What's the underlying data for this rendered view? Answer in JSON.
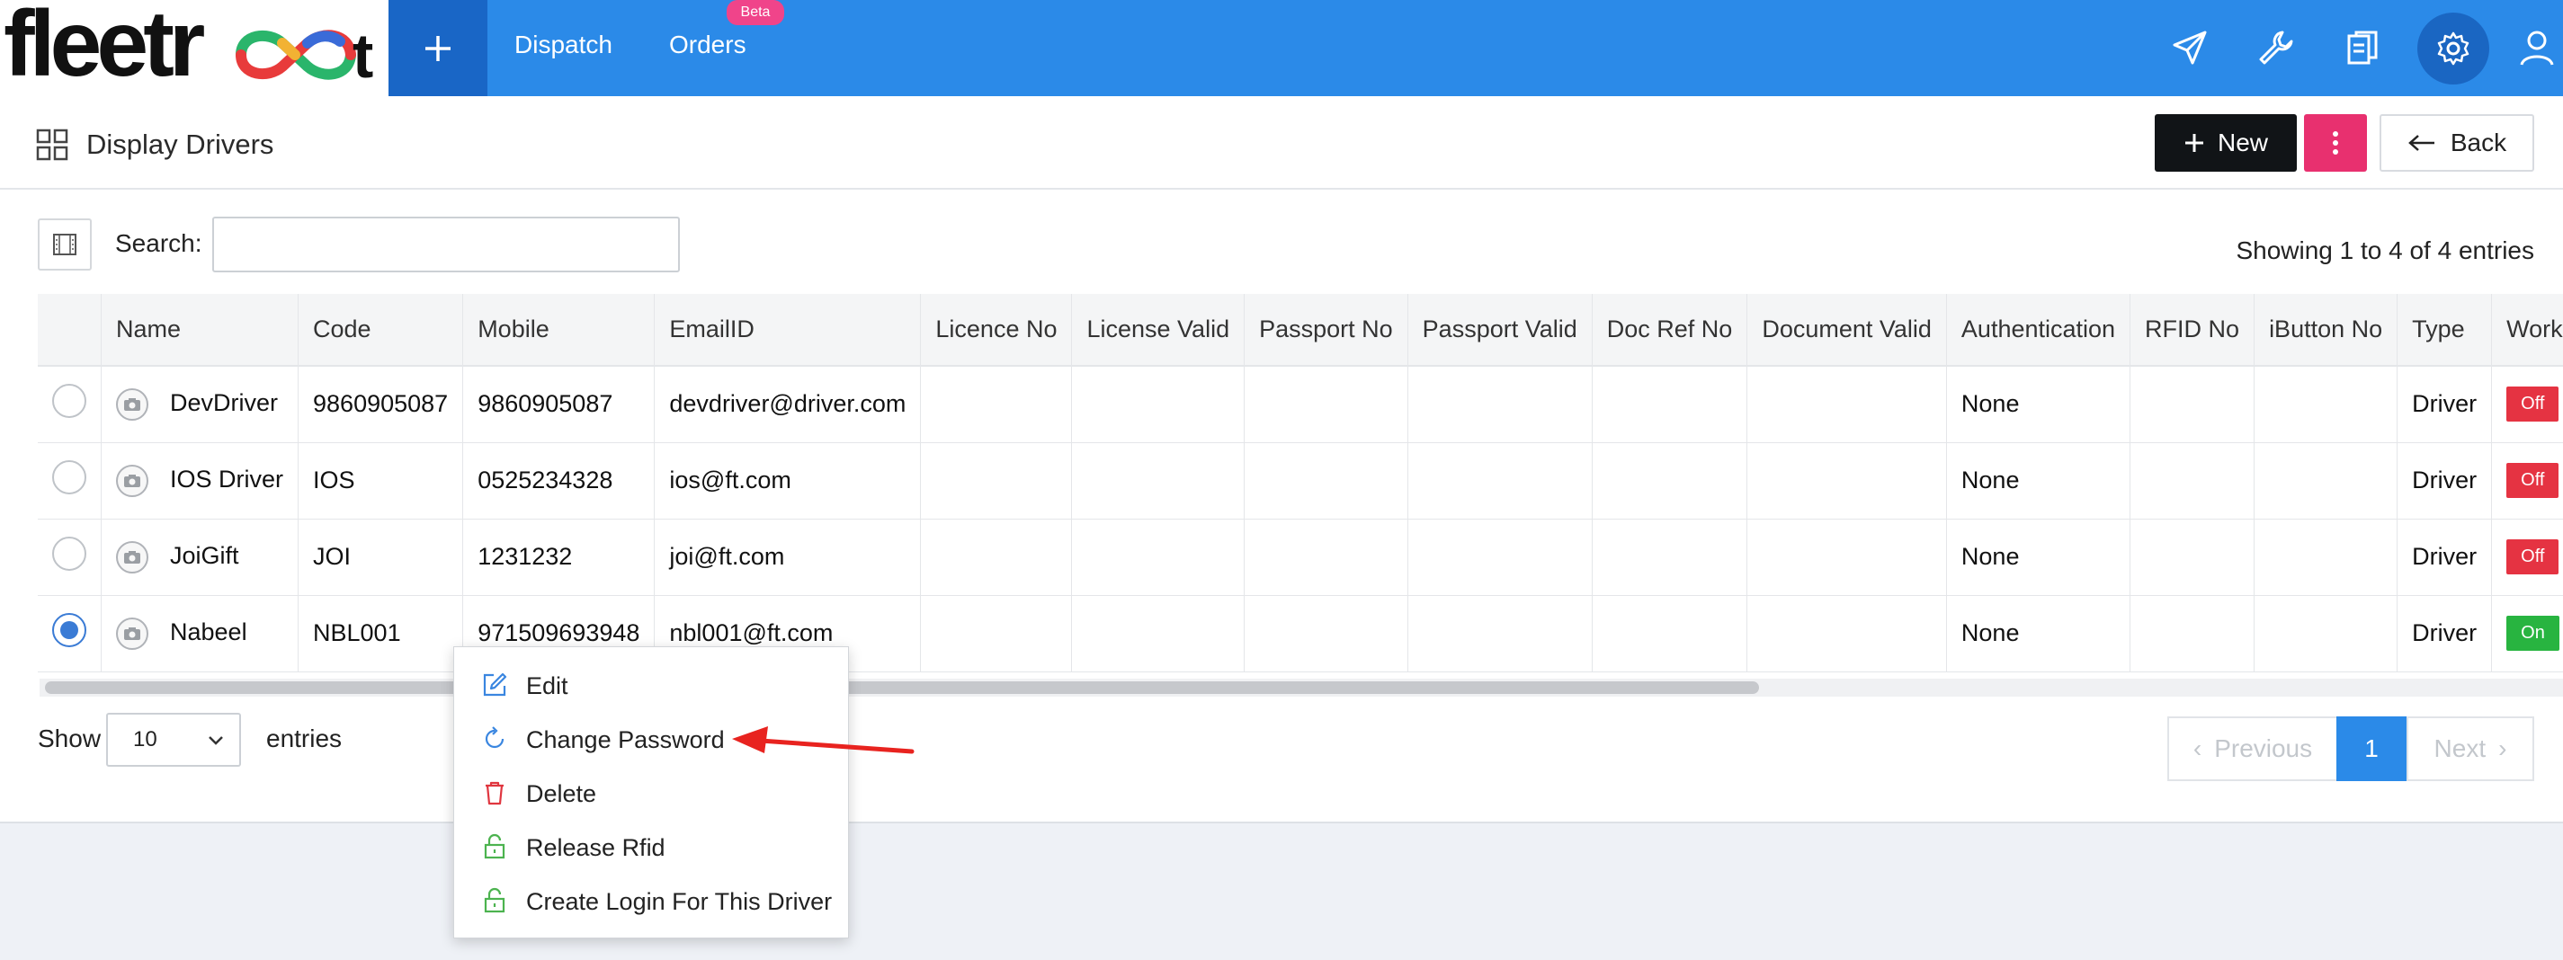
{
  "topbar": {
    "logo_text": "fleetroot",
    "nav": [
      {
        "label": "Dispatch"
      },
      {
        "label": "Orders"
      }
    ],
    "orders_badge": "Beta",
    "icons": [
      "send-icon",
      "wrench-icon",
      "clipboard-icon",
      "gear-icon",
      "user-icon"
    ]
  },
  "page": {
    "title": "Display Drivers",
    "new_label": "New",
    "back_label": "Back"
  },
  "search": {
    "label": "Search:",
    "value": "",
    "placeholder": ""
  },
  "showing_text": "Showing 1 to 4 of 4 entries",
  "table": {
    "columns": [
      "",
      "Name",
      "Code",
      "Mobile",
      "EmailID",
      "Licence No",
      "License Valid",
      "Passport No",
      "Passport Valid",
      "Doc Ref No",
      "Document Valid",
      "Authentication",
      "RFID No",
      "iButton No",
      "Type",
      "Work"
    ],
    "rows": [
      {
        "selected": false,
        "name": "DevDriver",
        "code": "9860905087",
        "mobile": "9860905087",
        "email": "devdriver@driver.com",
        "licence_no": "",
        "license_valid": "",
        "passport_no": "",
        "passport_valid": "",
        "doc_ref_no": "",
        "document_valid": "",
        "authentication": "None",
        "rfid_no": "",
        "ibutton_no": "",
        "type": "Driver",
        "work": "Off"
      },
      {
        "selected": false,
        "name": "IOS Driver",
        "code": "IOS",
        "mobile": "0525234328",
        "email": "ios@ft.com",
        "licence_no": "",
        "license_valid": "",
        "passport_no": "",
        "passport_valid": "",
        "doc_ref_no": "",
        "document_valid": "",
        "authentication": "None",
        "rfid_no": "",
        "ibutton_no": "",
        "type": "Driver",
        "work": "Off"
      },
      {
        "selected": false,
        "name": "JoiGift",
        "code": "JOI",
        "mobile": "1231232",
        "email": "joi@ft.com",
        "licence_no": "",
        "license_valid": "",
        "passport_no": "",
        "passport_valid": "",
        "doc_ref_no": "",
        "document_valid": "",
        "authentication": "None",
        "rfid_no": "",
        "ibutton_no": "",
        "type": "Driver",
        "work": "Off"
      },
      {
        "selected": true,
        "name": "Nabeel",
        "code": "NBL001",
        "mobile": "971509693948",
        "email": "nbl001@ft.com",
        "licence_no": "",
        "license_valid": "",
        "passport_no": "",
        "passport_valid": "",
        "doc_ref_no": "",
        "document_valid": "",
        "authentication": "None",
        "rfid_no": "",
        "ibutton_no": "",
        "type": "Driver",
        "work": "On"
      }
    ]
  },
  "length": {
    "show_label": "Show",
    "value": "10",
    "entries_label": "entries"
  },
  "pagination": {
    "previous": "Previous",
    "current": "1",
    "next": "Next"
  },
  "context_menu": {
    "items": [
      {
        "label": "Edit",
        "icon": "edit-icon"
      },
      {
        "label": "Change Password",
        "icon": "refresh-icon"
      },
      {
        "label": "Delete",
        "icon": "trash-icon"
      },
      {
        "label": "Release Rfid",
        "icon": "unlock-icon"
      },
      {
        "label": "Create Login For This Driver",
        "icon": "unlock-icon"
      }
    ]
  },
  "colors": {
    "topbar": "#2b8ae8",
    "accent_pink": "#e8306f",
    "off": "#e53342",
    "on": "#28b440"
  }
}
